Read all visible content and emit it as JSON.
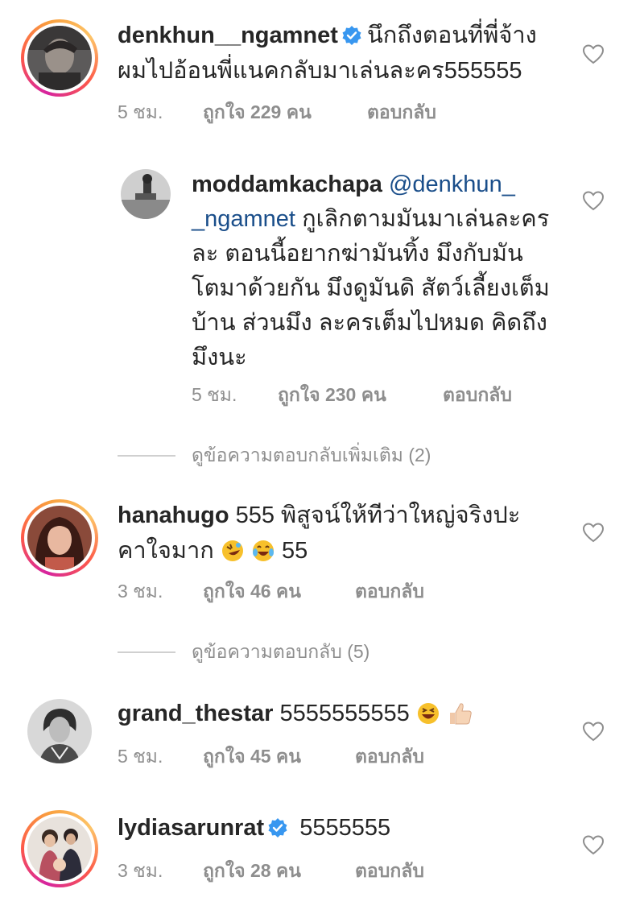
{
  "comments": [
    {
      "username": "denkhun__ngamnet",
      "verified": true,
      "text_line1": "นึกถึงตอนที่พี่จ้าง",
      "text_line2": "ผมไปอ้อนพี่แนคกลับมาเล่นละคร555555",
      "time": "5 ชม.",
      "likes": "ถูกใจ 229 คน",
      "reply": "ตอบกลับ",
      "story_ring": true
    },
    {
      "username": "moddamkachapa",
      "mention_part1": "@denkhun_",
      "mention_part2": "_ngamnet",
      "text_line1_rest": "กูเลิกตามมันมาเล่นละคร",
      "text_line2": "ละ ตอนนี้อยากฆ่ามันทิ้ง มึงกับมัน",
      "text_line3": "โตมาด้วยกัน มึงดูมันดิ สัตว์เลี้ยงเต็ม",
      "text_line4": "บ้าน ส่วนมึง ละครเต็มไปหมด คิดถึง",
      "text_line5": "มึงนะ",
      "time": "5 ชม.",
      "likes": "ถูกใจ 230 คน",
      "reply": "ตอบกลับ",
      "is_reply": true
    },
    {
      "username": "hanahugo",
      "text_line1": "555 พิสูจน์ให้ทีว่าใหญ่จริงปะ",
      "text_line2": "คาใจมาก",
      "text_line2_suffix": "55",
      "emojis": [
        "rolling-laughing-emoji",
        "joy-emoji"
      ],
      "time": "3 ชม.",
      "likes": "ถูกใจ 46 คน",
      "reply": "ตอบกลับ",
      "story_ring": true
    },
    {
      "username": "grand_thestar",
      "text_line1": "5555555555",
      "emojis": [
        "laughing-emoji",
        "thumbs-up-emoji"
      ],
      "time": "5 ชม.",
      "likes": "ถูกใจ 45 คน",
      "reply": "ตอบกลับ",
      "story_ring": false
    },
    {
      "username": "lydiasarunrat",
      "verified": true,
      "text_line1": "5555555",
      "time": "3 ชม.",
      "likes": "ถูกใจ 28 คน",
      "reply": "ตอบกลับ",
      "story_ring": true
    }
  ],
  "view_more": [
    {
      "label": "ดูข้อความตอบกลับเพิ่มเติม (2)"
    },
    {
      "label": "ดูข้อความตอบกลับ (5)"
    }
  ],
  "icons": {
    "like": "heart-outline-icon",
    "verified": "verified-badge-icon"
  },
  "colors": {
    "mention": "#1a4e8a",
    "meta": "#8e8e8e",
    "verified": "#3897f0",
    "text": "#262626"
  }
}
